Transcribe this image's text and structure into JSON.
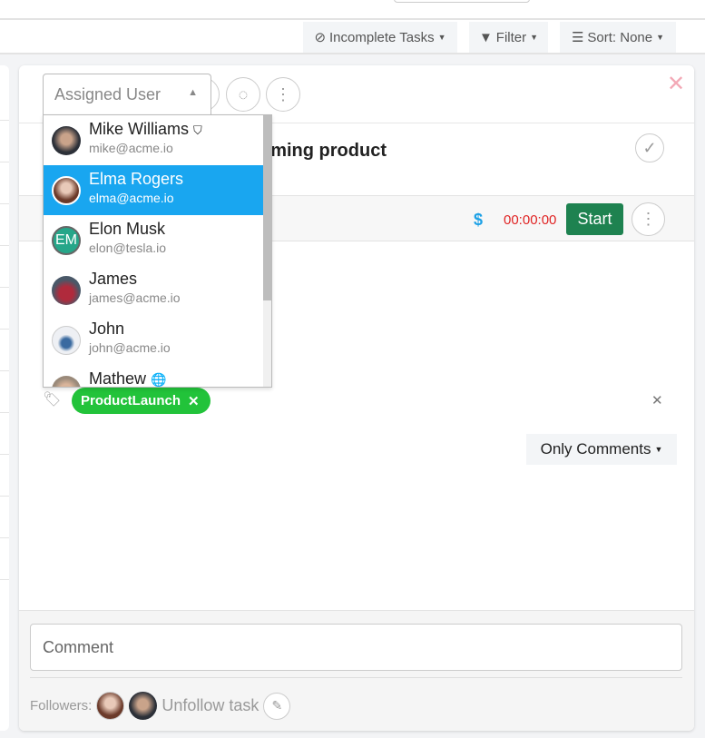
{
  "toolbar": {
    "incomplete": "Incomplete Tasks",
    "filter": "Filter",
    "sort": "Sort: None"
  },
  "task": {
    "title": "oming product",
    "timer": "00:00:00",
    "currency_icon": "$",
    "start": "Start",
    "tag": "ProductLaunch",
    "comments_filter": "Only Comments",
    "comment_placeholder": "Comment",
    "followers_label": "Followers:",
    "unfollow": "Unfollow task"
  },
  "dropdown": {
    "placeholder": "Assigned User",
    "items": [
      {
        "name": "Mike Williams",
        "email": "mike@acme.io",
        "badge": "shield-icon"
      },
      {
        "name": "Elma Rogers",
        "email": "elma@acme.io",
        "selected": true
      },
      {
        "name": "Elon Musk",
        "email": "elon@tesla.io",
        "initials": "EM"
      },
      {
        "name": "James",
        "email": "james@acme.io"
      },
      {
        "name": "John",
        "email": "john@acme.io"
      },
      {
        "name": "Mathew",
        "email": "",
        "badge": "globe-icon"
      }
    ]
  },
  "colors": {
    "selected": "#19a6f0",
    "start": "#1e8250",
    "tag": "#22c33a",
    "timer": "#e02424"
  }
}
